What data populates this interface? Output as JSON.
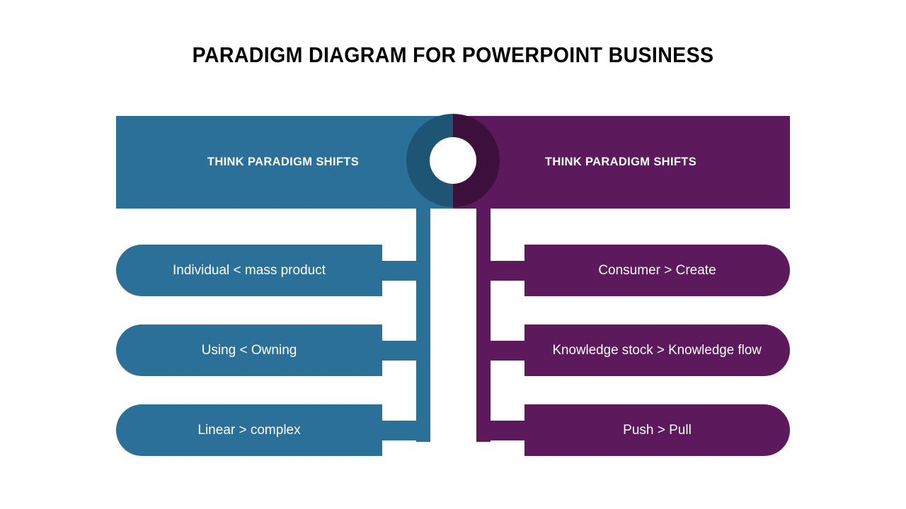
{
  "title": "PARADIGM DIAGRAM FOR POWERPOINT BUSINESS",
  "colors": {
    "blue": "#2A7099",
    "blue_dark": "#1F5574",
    "purple": "#5C1A5C",
    "purple_dark": "#3D0F3D",
    "text_on_fill": "#FFFFFF",
    "title_color": "#000000",
    "background": "#FFFFFF"
  },
  "left": {
    "header": "THINK PARADIGM SHIFTS",
    "items": [
      {
        "label": "Individual < mass product"
      },
      {
        "label": "Using < Owning"
      },
      {
        "label": "Linear > complex"
      }
    ]
  },
  "right": {
    "header": "THINK PARADIGM SHIFTS",
    "items": [
      {
        "label": "Consumer  > Create"
      },
      {
        "label": "Knowledge stock > Knowledge flow"
      },
      {
        "label": "Push > Pull"
      }
    ]
  }
}
